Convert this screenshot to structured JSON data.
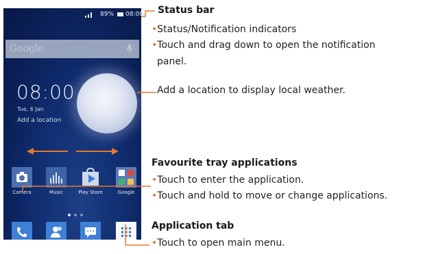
{
  "phone": {
    "status_bar": {
      "battery": "89%",
      "time": "08:00"
    },
    "search_label": "Google",
    "clock": "08:00",
    "date": "Tue,  6 Jan",
    "add_location": "Add a location",
    "apps": [
      {
        "label": "Camera",
        "icon": "camera-icon"
      },
      {
        "label": "Music",
        "icon": "music-icon"
      },
      {
        "label": "Play Store",
        "icon": "play-store-icon"
      },
      {
        "label": "Google",
        "icon": "google-folder-icon"
      }
    ],
    "dock": [
      {
        "icon": "phone-icon"
      },
      {
        "icon": "contacts-icon"
      },
      {
        "icon": "messages-icon"
      },
      {
        "icon": "app-drawer-icon"
      }
    ]
  },
  "callouts": {
    "status_bar": {
      "title": "Status bar",
      "bullets": [
        "Status/Notification indicators",
        "Touch and drag down to open the notification",
        "panel."
      ]
    },
    "weather": {
      "text": "Add a location to display local weather."
    },
    "favourite_tray": {
      "title": "Favourite tray applications",
      "bullets": [
        "Touch to enter the application.",
        "Touch and hold to move or change applications."
      ]
    },
    "application_tab": {
      "title": "Application tab",
      "bullets": [
        "Touch to open main menu."
      ]
    }
  },
  "colors": {
    "accent": "#e8792a",
    "phone_bg": "#0f2c6e",
    "text": "#1a1a1a"
  }
}
